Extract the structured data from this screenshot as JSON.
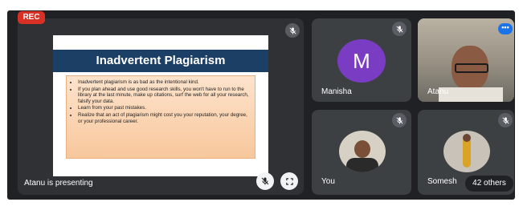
{
  "recording_badge": "REC",
  "presentation": {
    "label": "Atanu is presenting",
    "slide": {
      "title": "Inadvertent Plagiarism",
      "bullets": [
        "Inadvertent plagiarism is as bad as the intentional kind.",
        "If you plan ahead and use good research skills, you won't have to run to the library at the last minute, make up citations, surf the web for all your research, falsify your data.",
        "Learn from your past mistakes.",
        "Realize that an act of plagiarism might cost you your reputation, your degree, or your professional career."
      ]
    }
  },
  "participants": {
    "manisha": {
      "name": "Manisha",
      "initial": "M",
      "avatar_color": "#7b3cc4"
    },
    "atanu": {
      "name": "Atanu"
    },
    "you": {
      "name": "You"
    },
    "somesh": {
      "name": "Somesh"
    }
  },
  "others_count": "42 others",
  "icons": {
    "mic_off": "mic-off-icon",
    "fullscreen": "fullscreen-icon",
    "more": "more-options-icon"
  },
  "colors": {
    "background": "#202124",
    "tile": "#3c4043",
    "rec": "#d93025",
    "slide_title_bar": "#1c3f66",
    "accent": "#1a73e8"
  }
}
